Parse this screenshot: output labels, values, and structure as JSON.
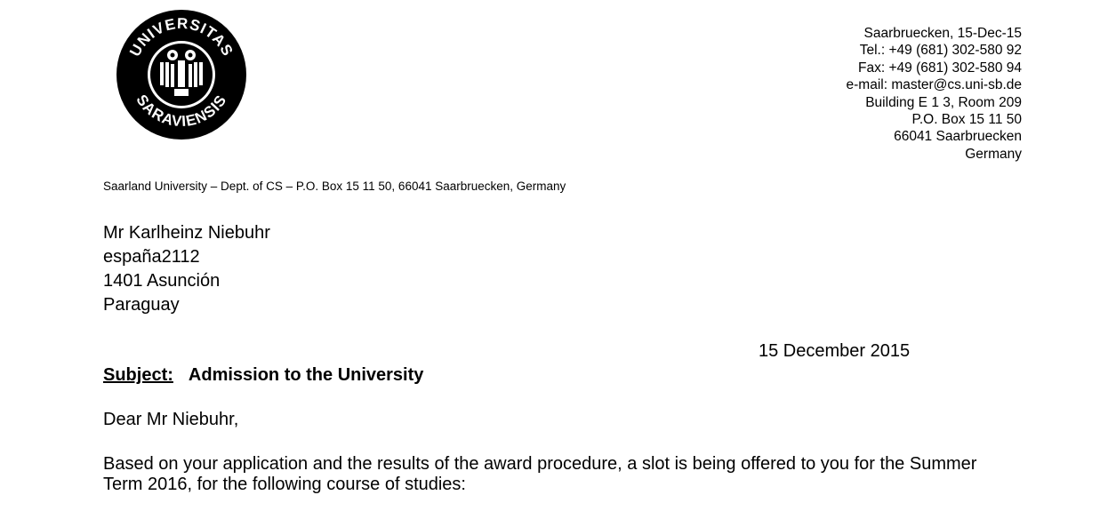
{
  "seal": {
    "text_top": "UNIVERSITAS",
    "text_bottom": "SARAVIENSIS"
  },
  "contact": {
    "lines": [
      "Saarbruecken, 15-Dec-15",
      "Tel.: +49 (681) 302-580 92",
      "Fax: +49 (681) 302-580 94",
      "e-mail: master@cs.uni-sb.de",
      "Building E 1 3, Room 209",
      "P.O. Box 15 11 50",
      "66041 Saarbruecken",
      "Germany"
    ]
  },
  "return_address": "Saarland University – Dept. of CS – P.O. Box 15 11 50, 66041 Saarbruecken, Germany",
  "recipient": {
    "lines": [
      "Mr Karlheinz Niebuhr",
      "españa2112",
      "1401 Asunción",
      "Paraguay"
    ]
  },
  "letter_date": "15 December 2015",
  "subject": {
    "label": "Subject:",
    "title": "Admission to the University"
  },
  "salutation": "Dear Mr Niebuhr,",
  "body": {
    "lines": [
      "Based on your application and the results of the award procedure, a slot is being offered to you for the Summer",
      "Term 2016, for the following course of studies:"
    ]
  }
}
